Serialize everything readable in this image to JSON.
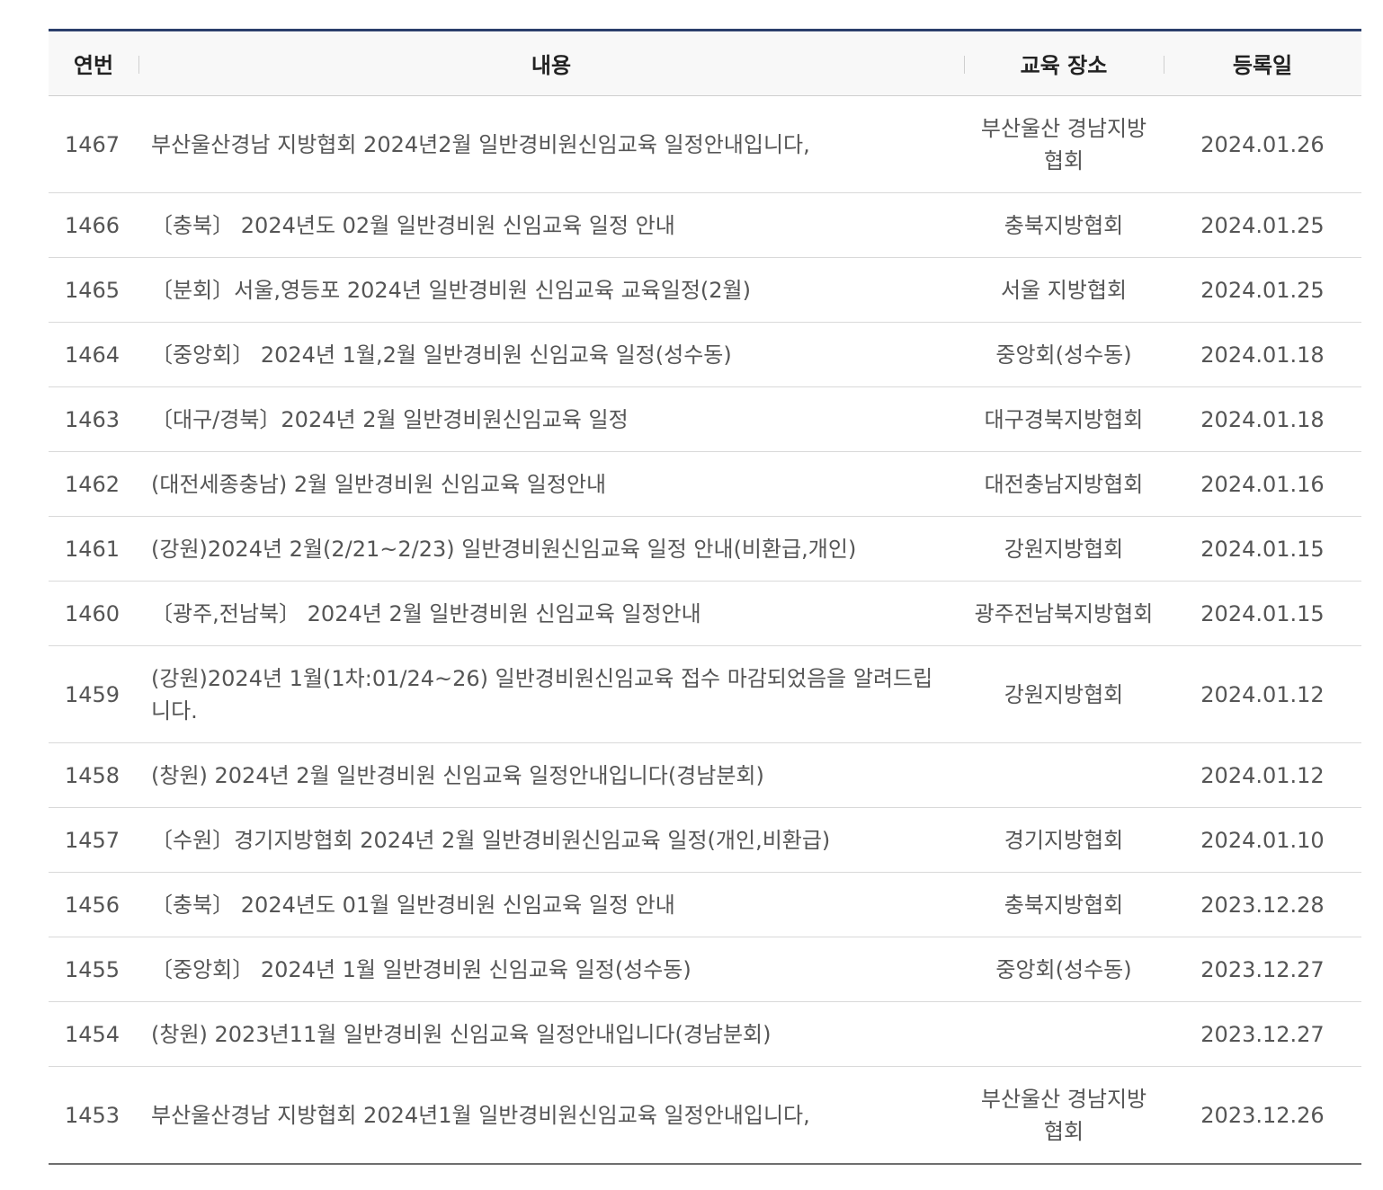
{
  "header": {
    "no": "연번",
    "title": "내용",
    "place": "교육 장소",
    "date": "등록일"
  },
  "rows": [
    {
      "no": "1467",
      "title": "부산울산경남 지방협회 2024년2월 일반경비원신임교육 일정안내입니다,",
      "place": "부산울산 경남지방협회",
      "date": "2024.01.26"
    },
    {
      "no": "1466",
      "title": "〔충북〕 2024년도 02월 일반경비원 신임교육 일정 안내",
      "place": "충북지방협회",
      "date": "2024.01.25"
    },
    {
      "no": "1465",
      "title": "〔분회〕서울,영등포 2024년 일반경비원 신임교육 교육일정(2월)",
      "place": "서울 지방협회",
      "date": "2024.01.25"
    },
    {
      "no": "1464",
      "title": "〔중앙회〕 2024년 1월,2월 일반경비원 신임교육 일정(성수동)",
      "place": "중앙회(성수동)",
      "date": "2024.01.18"
    },
    {
      "no": "1463",
      "title": "〔대구/경북〕2024년 2월 일반경비원신임교육 일정",
      "place": "대구경북지방협회",
      "date": "2024.01.18"
    },
    {
      "no": "1462",
      "title": "(대전세종충남) 2월 일반경비원 신임교육 일정안내",
      "place": "대전충남지방협회",
      "date": "2024.01.16"
    },
    {
      "no": "1461",
      "title": "(강원)2024년 2월(2/21~2/23) 일반경비원신임교육 일정 안내(비환급,개인)",
      "place": "강원지방협회",
      "date": "2024.01.15"
    },
    {
      "no": "1460",
      "title": "〔광주,전남북〕 2024년 2월 일반경비원 신임교육 일정안내",
      "place": "광주전남북지방협회",
      "date": "2024.01.15"
    },
    {
      "no": "1459",
      "title": "(강원)2024년 1월(1차:01/24~26) 일반경비원신임교육 접수 마감되었음을 알려드립니다.",
      "place": "강원지방협회",
      "date": "2024.01.12"
    },
    {
      "no": "1458",
      "title": "(창원) 2024년 2월 일반경비원 신임교육 일정안내입니다(경남분회)",
      "place": "",
      "date": "2024.01.12"
    },
    {
      "no": "1457",
      "title": "〔수원〕경기지방협회 2024년 2월 일반경비원신임교육 일정(개인,비환급)",
      "place": "경기지방협회",
      "date": "2024.01.10"
    },
    {
      "no": "1456",
      "title": "〔충북〕 2024년도 01월 일반경비원 신임교육 일정 안내",
      "place": "충북지방협회",
      "date": "2023.12.28"
    },
    {
      "no": "1455",
      "title": "〔중앙회〕 2024년 1월 일반경비원 신임교육 일정(성수동)",
      "place": "중앙회(성수동)",
      "date": "2023.12.27"
    },
    {
      "no": "1454",
      "title": "(창원) 2023년11월 일반경비원 신임교육 일정안내입니다(경남분회)",
      "place": "",
      "date": "2023.12.27"
    },
    {
      "no": "1453",
      "title": "부산울산경남 지방협회 2024년1월 일반경비원신임교육 일정안내입니다,",
      "place": "부산울산 경남지방협회",
      "date": "2023.12.26"
    }
  ]
}
